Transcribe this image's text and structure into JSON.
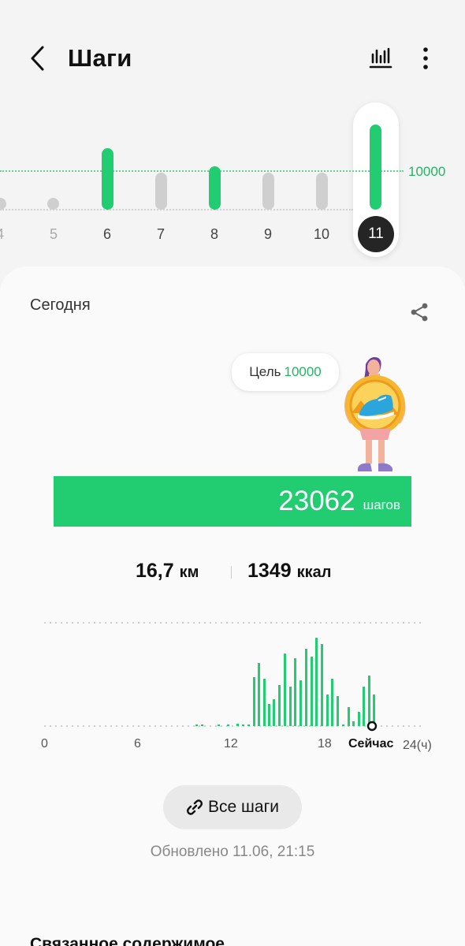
{
  "header": {
    "title": "Шаги",
    "back_icon": "chevron-left-icon",
    "trend_icon": "bar-chart-icon",
    "more_icon": "more-vertical-icon"
  },
  "strip": {
    "goal_label": "10000",
    "days": [
      {
        "label": "4",
        "steps_fraction": 0.0
      },
      {
        "label": "5",
        "steps_fraction": 0.0
      },
      {
        "label": "6",
        "steps_fraction": 1.0
      },
      {
        "label": "7",
        "steps_fraction": 0.6
      },
      {
        "label": "8",
        "steps_fraction": 0.7
      },
      {
        "label": "9",
        "steps_fraction": 0.6
      },
      {
        "label": "10",
        "steps_fraction": 0.6
      },
      {
        "label": "11",
        "steps_fraction": 1.0,
        "selected": true
      }
    ]
  },
  "summary": {
    "period": "Сегодня",
    "share_icon": "share-icon",
    "goal_prefix": "Цель",
    "goal_value": "10000",
    "steps": "23062",
    "steps_unit": "шагов",
    "distance_value": "16,7",
    "distance_unit": "км",
    "calories_value": "1349",
    "calories_unit": "ккал"
  },
  "hourly": {
    "axis_labels": [
      "0",
      "6",
      "12",
      "18"
    ],
    "now_label": "Сейчас",
    "end_label": "24(ч)"
  },
  "actions": {
    "all_steps": "Все шаги",
    "link_icon": "link-icon"
  },
  "updated": "Обновлено 11.06, 21:15",
  "related_title": "Связанное содержимое",
  "colors": {
    "accent": "#22cd72",
    "accent_text": "#22b563",
    "inactive": "#cfcfcf",
    "selected_day": "#252525"
  }
}
